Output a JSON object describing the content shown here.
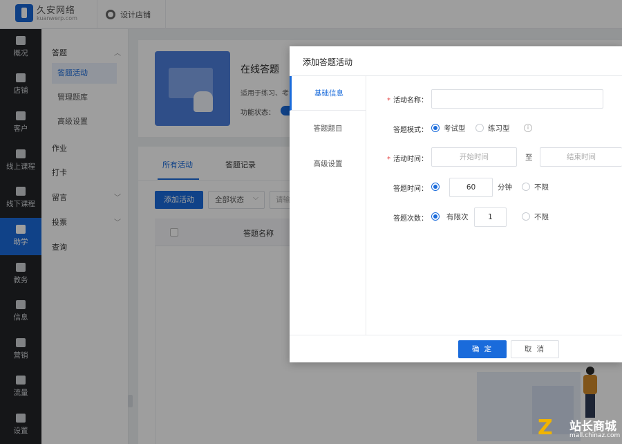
{
  "topbar": {
    "brand_name": "久安网络",
    "brand_domain": "kuanwerp.com",
    "design_store": "设计店铺"
  },
  "leftnav": [
    {
      "label": "概况",
      "icon": "chart-icon"
    },
    {
      "label": "店铺",
      "icon": "store-icon"
    },
    {
      "label": "客户",
      "icon": "customer-icon"
    },
    {
      "label": "线上课程",
      "icon": "online-course-icon"
    },
    {
      "label": "线下课程",
      "icon": "offline-course-icon"
    },
    {
      "label": "助学",
      "icon": "gamepad-icon",
      "active": true
    },
    {
      "label": "教务",
      "icon": "academic-icon"
    },
    {
      "label": "信息",
      "icon": "message-icon"
    },
    {
      "label": "营销",
      "icon": "tag-icon"
    },
    {
      "label": "流量",
      "icon": "megaphone-icon"
    },
    {
      "label": "设置",
      "icon": "gear-icon"
    }
  ],
  "subnav": {
    "group_quiz": "答题",
    "children": [
      "答题活动",
      "管理题库",
      "高级设置"
    ],
    "homework": "作业",
    "checkin": "打卡",
    "message": "留言",
    "vote": "投票",
    "survey": "查询"
  },
  "card": {
    "title": "在线答题",
    "desc": "适用于练习、考试",
    "status_label": "功能状态："
  },
  "list": {
    "tabs": [
      "所有活动",
      "答题记录"
    ],
    "add_button": "添加活动",
    "status_filter": "全部状态",
    "search_placeholder": "请输入",
    "col_name": "答题名称"
  },
  "modal": {
    "title": "添加答题活动",
    "tabs": [
      "基础信息",
      "答题题目",
      "高级设置"
    ],
    "activity_name_label": "活动名称：",
    "mode_label": "答题模式：",
    "mode_exam": "考试型",
    "mode_practice": "练习型",
    "info_mark": "i",
    "time_label": "活动时间：",
    "start_placeholder": "开始时间",
    "to_text": "至",
    "end_placeholder": "结束时间",
    "duration_label": "答题时间：",
    "duration_value": "60",
    "duration_unit": "分钟",
    "unlimited": "不限",
    "attempts_label": "答题次数：",
    "attempts_limited": "有限次",
    "attempts_value": "1",
    "confirm": "确 定",
    "cancel": "取 消"
  },
  "watermark": {
    "name": "站长商城",
    "url": "mall.chinaz.com"
  }
}
